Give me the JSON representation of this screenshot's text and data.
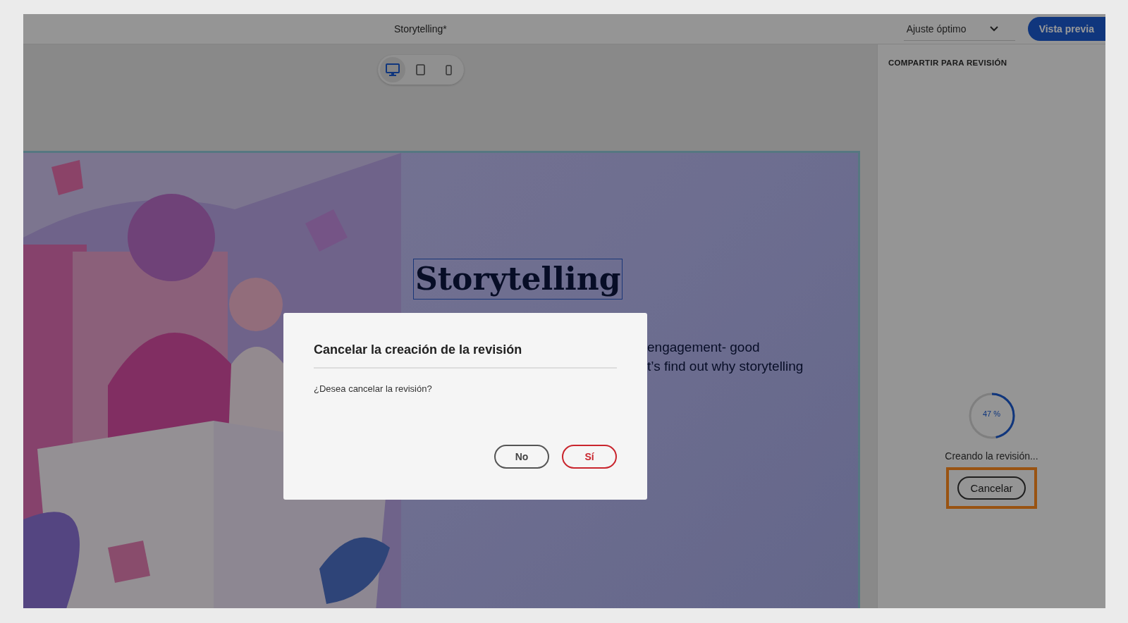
{
  "top_bar": {
    "document_title": "Storytelling*",
    "zoom_select": "Ajuste óptimo",
    "preview_button": "Vista previa"
  },
  "device_toggles": [
    {
      "kind": "desktop",
      "selected": true
    },
    {
      "kind": "tablet",
      "selected": false
    },
    {
      "kind": "phone",
      "selected": false
    }
  ],
  "page": {
    "picture": {
      "kind": "picture"
    },
    "heading": "Storytelling",
    "body_lines": [
      "engagement- good",
      "t’s find out why storytelling"
    ]
  },
  "side_panel": {
    "title": "COMPARTIR PARA REVISIÓN",
    "progress": {
      "level": 0.47,
      "reading": "47 %"
    },
    "status": "Creando la revisión...",
    "cancel_button": "Cancelar",
    "cancel_highlighted": true
  },
  "dialog": {
    "title": "Cancelar la creación de la revisión",
    "message": "¿Desea cancelar la revisión?",
    "buttons": [
      {
        "label": "No",
        "kind": "secondary"
      },
      {
        "label": "Sí",
        "kind": "negative"
      }
    ]
  }
}
